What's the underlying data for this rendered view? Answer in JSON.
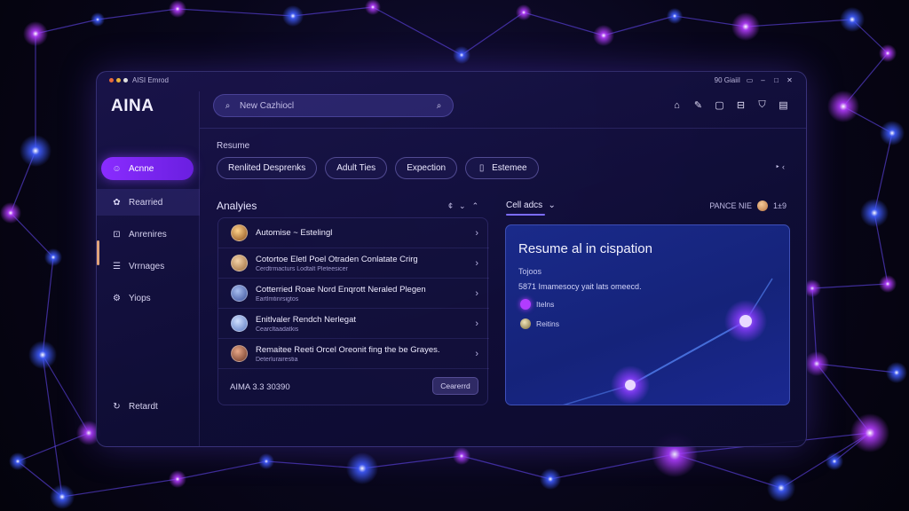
{
  "window": {
    "title": "AISI Emrod",
    "right_text": "90 GiaiiI",
    "controls": [
      "chat-icon",
      "minimize-icon",
      "maximize-icon",
      "close-icon"
    ]
  },
  "sidebar": {
    "brand": "AINA",
    "active_item": {
      "label": "Acnne",
      "icon": "bot-icon"
    },
    "items": [
      {
        "label": "Rearried",
        "icon": "brain-icon"
      },
      {
        "label": "Anrenires",
        "icon": "lock-icon"
      },
      {
        "label": "Vrrnages",
        "icon": "layers-icon"
      },
      {
        "label": "Yiops",
        "icon": "gear-icon"
      }
    ],
    "footer_item": {
      "label": "Retardt",
      "icon": "refresh-icon"
    }
  },
  "header": {
    "search_placeholder": "New Cazhiocl",
    "icons": [
      "home-icon",
      "pen-icon",
      "document-icon",
      "inbox-icon",
      "shield-icon",
      "save-icon"
    ]
  },
  "resume": {
    "label": "Resume",
    "chips": [
      "Renlited Desprenks",
      "Adult Ties",
      "Expection",
      "Estemee"
    ],
    "more": "‣ ‹"
  },
  "analytics": {
    "heading": "Analyies",
    "controls": [
      "¢",
      "⌄",
      "⌃"
    ],
    "rows": [
      {
        "title": "Automise ~ Estelingl",
        "sub": "",
        "avatar": "#d9a65a"
      },
      {
        "title": "Cotortoe Eletl Poel Otraden Conlatate Crirg",
        "sub": "Cerdtrmacturs Lodtalt Pleteesicer",
        "avatar": "#e1b482"
      },
      {
        "title": "Cotterried Roae Nord Enqrott Neraled Plegen",
        "sub": "Eartlmtinrsigtos",
        "avatar": "#6d86c9"
      },
      {
        "title": "Enitlvaler Rendch Nerlegat",
        "sub": "Cearcltaadatkis",
        "avatar": "#8aa7e0"
      },
      {
        "title": "Remaitee Reeti Orcel Oreonit fing the be Grayes.",
        "sub": "Deterlurairestia",
        "avatar": "#b96c4f"
      }
    ],
    "footer_text": "AIMA 3.3 30390",
    "footer_button": "Cearerrd"
  },
  "detail": {
    "tab": "Cell adcs",
    "tab_right": "PANCE NIE",
    "tab_right_num": "1±9",
    "card_title": "Resume al in cispation",
    "card_label": "Tojoos",
    "card_text": "5871 Imamesocy yait lats omeecd.",
    "options": [
      {
        "label": "Itelns",
        "color": "#b23cff"
      },
      {
        "label": "Reitins",
        "color": "#c7b27a"
      }
    ]
  },
  "colors": {
    "accent": "#8a2cff",
    "card": "#1a2a8a",
    "window": "#1c1650"
  }
}
